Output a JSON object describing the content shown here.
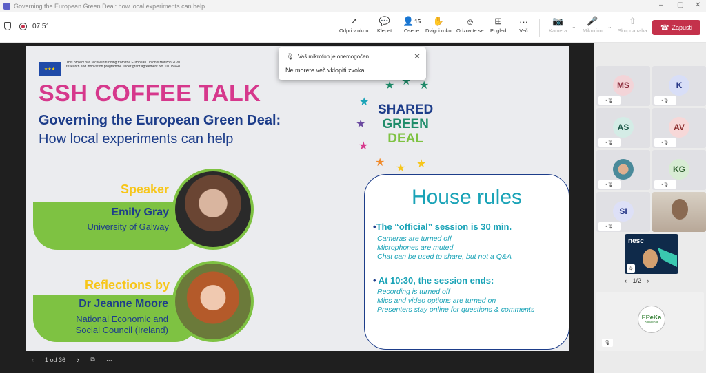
{
  "window": {
    "title": "Governing the European Green Deal: how local experiments can help",
    "minimize": "–",
    "maximize": "▢",
    "close": "✕"
  },
  "toolbar": {
    "timer": "07:51",
    "buttons": [
      {
        "label": "Odpri v oknu",
        "icon": "↗"
      },
      {
        "label": "Klepet",
        "icon": "💬"
      },
      {
        "label": "Osebe",
        "icon": "👤",
        "badge": "15"
      },
      {
        "label": "Dvigni roko",
        "icon": "✋"
      },
      {
        "label": "Odzovite se",
        "icon": "☺"
      },
      {
        "label": "Pogled",
        "icon": "⊞"
      },
      {
        "label": "Več",
        "icon": "···"
      },
      {
        "label": "Kamera",
        "icon": "📷"
      },
      {
        "label": "Mikrofon",
        "icon": "🎤"
      },
      {
        "label": "Skupna raba",
        "icon": "⇧"
      }
    ],
    "leave_label": "Zapusti"
  },
  "toast": {
    "title": "Vaš mikrofon je onemogočen",
    "message": "Ne morete več vklopiti zvoka."
  },
  "slide": {
    "eu_text": "This project has received funding from the European Union's Horizon 2020 research and innovation programme under grant agreement No 101036640.",
    "title": "SSH COFFEE TALK",
    "subtitle1": "Governing the European Green Deal:",
    "subtitle2": "How local experiments can help",
    "logo": {
      "line1": "SHARED",
      "line2": "GREEN",
      "line3": "DEAL"
    },
    "speaker": {
      "label": "Speaker",
      "name": "Emily Gray",
      "org": "University of Galway"
    },
    "reflections": {
      "label": "Reflections by",
      "name": "Dr Jeanne Moore",
      "org1": "National Economic and",
      "org2": "Social Council (Ireland)"
    },
    "rules": {
      "title": "House rules",
      "b1": "The “official” session is 30 min.",
      "b1_items": [
        "Cameras are turned off",
        "Microphones are muted",
        "Chat can be used to share, but not a Q&A"
      ],
      "b2": "At 10:30, the session ends:",
      "b2_items": [
        "Recording is turned off",
        "Mics and video options are turned on",
        "Presenters stay online for questions & comments"
      ]
    },
    "colors": {
      "pink": "#d6388c",
      "navy": "#1d3d8a",
      "teal": "#1aa3b7",
      "green": "#7ec242",
      "yellow": "#f7c61a"
    }
  },
  "slide_nav": {
    "counter": "1 od 36"
  },
  "participants": [
    {
      "initials": "MS",
      "bg": "#f3d4d8",
      "fg": "#8a2a3a"
    },
    {
      "initials": "K",
      "bg": "#d8def7",
      "fg": "#2a3a8a"
    },
    {
      "initials": "AS",
      "bg": "#d4ece6",
      "fg": "#1f5a4a"
    },
    {
      "initials": "AV",
      "bg": "#f7d8d8",
      "fg": "#8a2a2a"
    },
    {
      "initials": "",
      "bg": "#b8d0c8",
      "fg": "#333"
    },
    {
      "initials": "KG",
      "bg": "#d8ecd4",
      "fg": "#2a5a2a"
    },
    {
      "initials": "SI",
      "bg": "#dde0f7",
      "fg": "#2a3a8a"
    }
  ],
  "pager": "1/2",
  "nesc_label": "nesc",
  "epeka": {
    "line1": "EPeKa",
    "line2": "Slovenia"
  }
}
